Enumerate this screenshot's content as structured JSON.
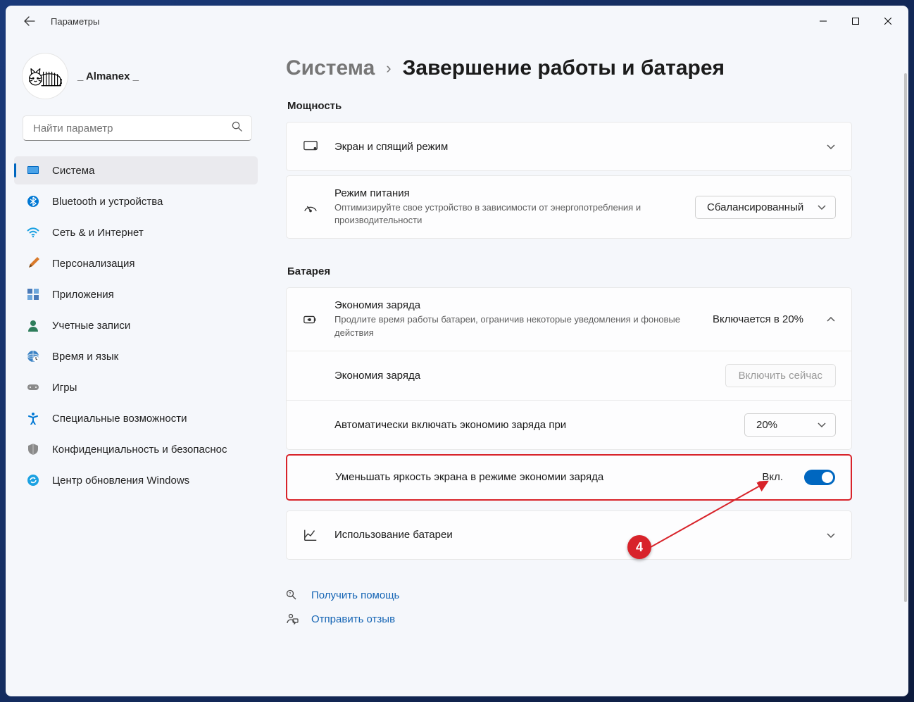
{
  "app_title": "Параметры",
  "user": {
    "name": "_ Almanex _"
  },
  "search": {
    "placeholder": "Найти параметр"
  },
  "nav": [
    {
      "label": "Система",
      "icon": "system"
    },
    {
      "label": "Bluetooth и устройства",
      "icon": "bluetooth"
    },
    {
      "label": "Сеть & и Интернет",
      "icon": "wifi"
    },
    {
      "label": "Персонализация",
      "icon": "brush"
    },
    {
      "label": "Приложения",
      "icon": "apps"
    },
    {
      "label": "Учетные записи",
      "icon": "user"
    },
    {
      "label": "Время и язык",
      "icon": "globe"
    },
    {
      "label": "Игры",
      "icon": "gamepad"
    },
    {
      "label": "Специальные возможности",
      "icon": "accessibility"
    },
    {
      "label": "Конфиденциальность и безопаснос",
      "icon": "shield"
    },
    {
      "label": "Центр обновления Windows",
      "icon": "update"
    }
  ],
  "breadcrumb": {
    "parent": "Система",
    "current": "Завершение работы и батарея"
  },
  "sections": {
    "power": {
      "label": "Мощность",
      "screen_sleep": {
        "title": "Экран и спящий режим"
      },
      "power_mode": {
        "title": "Режим питания",
        "sub": "Оптимизируйте свое устройство в зависимости от энергопотребления и производительности",
        "value": "Сбалансированный"
      }
    },
    "battery": {
      "label": "Батарея",
      "saver": {
        "title": "Экономия заряда",
        "sub": "Продлите время работы батареи, ограничив некоторые уведомления и фоновые действия",
        "summary": "Включается в 20%",
        "rows": {
          "now": {
            "label": "Экономия заряда",
            "button": "Включить сейчас"
          },
          "auto": {
            "label": "Автоматически включать экономию заряда при",
            "value": "20%"
          },
          "dim": {
            "label": "Уменьшать яркость экрана в режиме экономии заряда",
            "state": "Вкл."
          }
        }
      },
      "usage": {
        "title": "Использование батареи"
      }
    }
  },
  "links": {
    "help": "Получить помощь",
    "feedback": "Отправить отзыв"
  },
  "annotation": {
    "number": "4"
  }
}
